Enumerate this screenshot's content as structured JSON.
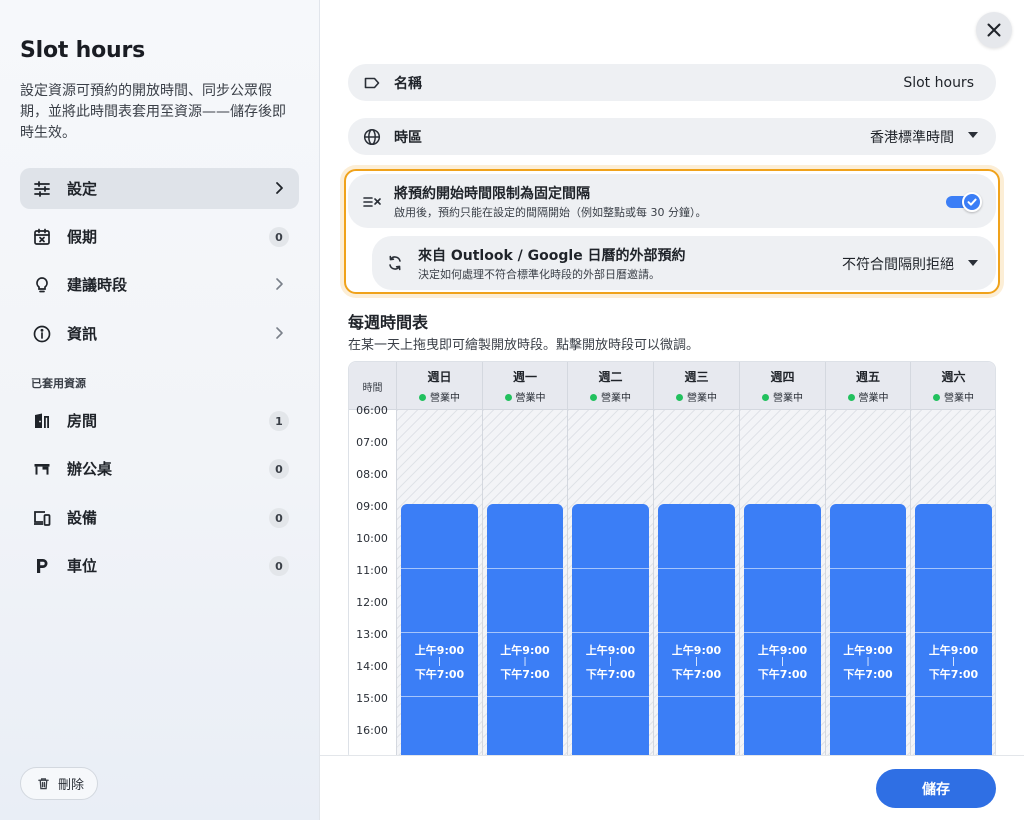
{
  "sidebar": {
    "title": "Slot hours",
    "description": "設定資源可預約的開放時間、同步公眾假期，並將此時間表套用至資源——儲存後即時生效。",
    "nav": {
      "settings": {
        "label": "設定",
        "icon": "sliders-icon"
      },
      "holidays": {
        "label": "假期",
        "icon": "calendar-x-icon",
        "badge": "0"
      },
      "suggested": {
        "label": "建議時段",
        "icon": "lightbulb-icon"
      },
      "info": {
        "label": "資訊",
        "icon": "info-icon"
      }
    },
    "applied_section_label": "已套用資源",
    "resources": {
      "rooms": {
        "label": "房間",
        "icon": "door-icon",
        "badge": "1"
      },
      "desks": {
        "label": "辦公桌",
        "icon": "desk-icon",
        "badge": "0"
      },
      "equipment": {
        "label": "設備",
        "icon": "devices-icon",
        "badge": "0"
      },
      "parking": {
        "label": "車位",
        "icon": "parking-icon",
        "badge": "0"
      }
    },
    "delete_label": "刪除"
  },
  "form": {
    "name": {
      "label": "名稱",
      "value": "Slot hours",
      "icon": "tag-icon"
    },
    "timezone": {
      "label": "時區",
      "value": "香港標準時間",
      "icon": "globe-icon"
    },
    "fixed_interval": {
      "title": "將預約開始時間限制為固定間隔",
      "subtitle": "啟用後，預約只能在設定的間隔開始（例如整點或每 30 分鐘）。",
      "enabled": true,
      "icon": "interval-icon"
    },
    "external": {
      "title": "來自 Outlook / Google 日曆的外部預約",
      "subtitle": "決定如何處理不符合標準化時段的外部日曆邀請。",
      "value": "不符合間隔則拒絕",
      "icon": "sync-icon"
    }
  },
  "schedule": {
    "title": "每週時間表",
    "description": "在某一天上拖曳即可繪製開放時段。點擊開放時段可以微調。",
    "time_header": "時間",
    "days": [
      {
        "name": "週日",
        "status": "營業中",
        "start": "上午9:00",
        "end": "下午7:00"
      },
      {
        "name": "週一",
        "status": "營業中",
        "start": "上午9:00",
        "end": "下午7:00"
      },
      {
        "name": "週二",
        "status": "營業中",
        "start": "上午9:00",
        "end": "下午7:00"
      },
      {
        "name": "週三",
        "status": "營業中",
        "start": "上午9:00",
        "end": "下午7:00"
      },
      {
        "name": "週四",
        "status": "營業中",
        "start": "上午9:00",
        "end": "下午7:00"
      },
      {
        "name": "週五",
        "status": "營業中",
        "start": "上午9:00",
        "end": "下午7:00"
      },
      {
        "name": "週六",
        "status": "營業中",
        "start": "上午9:00",
        "end": "下午7:00"
      }
    ],
    "hours": [
      "06:00",
      "07:00",
      "08:00",
      "09:00",
      "10:00",
      "11:00",
      "12:00",
      "13:00",
      "14:00",
      "15:00",
      "16:00"
    ],
    "separator": "|"
  },
  "footer": {
    "save_label": "儲存"
  },
  "colors": {
    "accent": "#3b7ef6",
    "highlight": "#f0a21a",
    "open_dot": "#22c15e"
  }
}
